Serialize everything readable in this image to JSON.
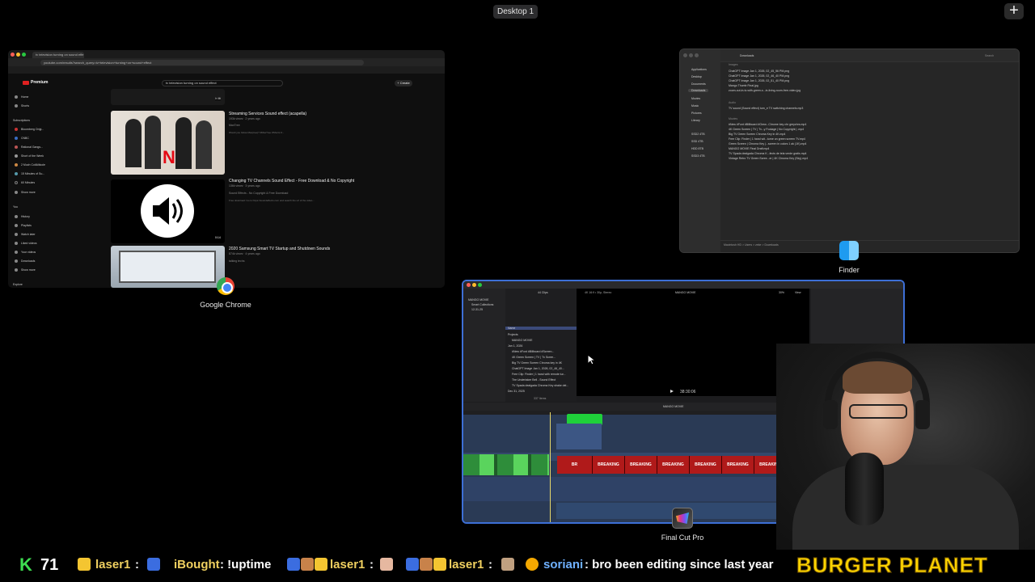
{
  "space": {
    "label": "Desktop 1",
    "add_symbol": "+"
  },
  "chrome": {
    "tab_title": "tv television turning on sound effe",
    "url": "youtube.com/results?search_query=tv+television+turning+on+sound+effect",
    "brand": "Premium",
    "search_query": "tv television turning on sound effect",
    "create_label": "+ Create",
    "sidebar": {
      "home": "Home",
      "shorts": "Shorts",
      "subscriptions": "Subscriptions",
      "subs": [
        "Bloomberg Origi...",
        "CNBC",
        "Rational Gangs...",
        "Short of the Week",
        "2 Much ColtAlticole",
        "15 Minutes of Su...",
        "60 Minutes"
      ],
      "show_more": "Show more",
      "you": "You",
      "you_items": [
        "History",
        "Playlists",
        "Watch later",
        "Liked videos",
        "Your videos",
        "Downloads",
        "Show more"
      ],
      "explore": "Explore"
    },
    "videos": [
      {
        "title": "Streaming Services Sound effect (acapella)",
        "meta": "193k views · 2 years ago",
        "channel": "MaxTree",
        "desc": "Would you follow Max(tree)? #MaxTree #Shorts #...",
        "duration": "0:38"
      },
      {
        "title": "Changing TV Channels Sound Effect - Free Download & No Copyright",
        "meta": "136k views · 3 years ago",
        "channel": "Sound Effects - No Copyright & Free Download",
        "desc": "Free download: Go to https://soundeffects.com and search the url of the video...",
        "duration": "0:14"
      },
      {
        "title": "2020 Samsung Smart TV Startup and Shutdown Sounds",
        "meta": "874k views · 4 years ago",
        "channel": "talking techs",
        "desc": "",
        "duration": ""
      }
    ],
    "thumb_text": "N"
  },
  "chrome_label": "Google Chrome",
  "finder": {
    "title": "Downloads",
    "search": "Search",
    "sidebar": [
      "Applications",
      "Desktop",
      "Documents",
      "Downloads",
      "Movies",
      "Music",
      "Pictures",
      "Library"
    ],
    "locations": [
      "SSD2 4TB",
      "SSD 4TB",
      "HDD 8TB",
      "SSD3 4TB"
    ],
    "sections": [
      "Images",
      "Audio",
      "Movies"
    ],
    "images": [
      "ChatGPT Image Jan 1, 2026, 02_45_56 PM.png",
      "ChatGPT Image Jan 1, 2026, 02_46_40 PM.png",
      "ChatGPT Image Jan 1, 2026, 02_51_40 PM.png",
      "Mango Thumb Final.jpg",
      "zoom-out-in-tv-with-green-s...in-living-room-free-video.jpg"
    ],
    "audio": [
      "TV sound (Sound effect) turn_e TV switching channels.mp3"
    ],
    "movies": [
      "#New #Font #Billboard #Grew...Chrome key chr greychrs.mp4",
      "4K Green Screen | TV | Tv...y Footage | No Copyright | .mp4",
      "Big TV Green Screen Chroma Key in 4K.mp4",
      "Free Clip: Finder | 1 hand wit...turne on green screen TV.mp4",
      "Green Screen | Chroma Key |...screen in colors 1 ak (1K).mp4",
      "MANGO MOVIE Final Draft.mp4",
      "TV Spada dealgada Chroma K...fects de tela verde gratis.mp4",
      "Vintage Retro TV Green Scree...er | 4K Chroma Key (Sky).mp4"
    ],
    "path": "Macintosh HD > Users > zeke > Downloads"
  },
  "finder_label": "Finder",
  "fcp": {
    "library": "MANGO MOVIE",
    "library_items": [
      "Smart Collections",
      "12-31-25"
    ],
    "clips_count": "44 Clips",
    "browser_header": "Name",
    "browser_items": [
      "Projects",
      "MANGO MOVIE",
      "Jan 1, 2026",
      "#New #Font #Billboard #Screen...",
      "4K Green Screen | TV | Tv Scree...",
      "Big TV Green Screen Chroma key in 4K",
      "ChatGPT Image Jan 1, 2026, 02_46_40...",
      "Free Clip: Finder | 1 hand with remote tur...",
      "The Undertaker Bell - Sound Effect",
      "TV Spada dealgada Chroma Key shake del...",
      "Dec 31, 2025"
    ],
    "items_count": "337 Items",
    "viewer_title": "MANGO MOVIE",
    "viewer_format": "4K 16:9 • 30p, Stereo",
    "zoom": "30%",
    "view": "View",
    "timecode": "38:30:06",
    "timeline_title": "MANGO MOVIE",
    "breaking": "BREAKING NEWS",
    "breaking_short": "BR",
    "accent": "#3d6fd6"
  },
  "fcp_label": "Final Cut Pro",
  "ticker": {
    "count_k": "K",
    "count_n": "71",
    "entries": [
      {
        "user": "laser1",
        "text": ":"
      },
      {
        "user": "iBought",
        "text": ": !uptime"
      },
      {
        "user": "laser1",
        "text": ":"
      },
      {
        "user": "laser1",
        "text": ":"
      },
      {
        "user": "laser1",
        "text": ":"
      },
      {
        "user": "soriani",
        "text": ": bro been editing since last year"
      }
    ],
    "brand": "BURGER PLANET"
  }
}
